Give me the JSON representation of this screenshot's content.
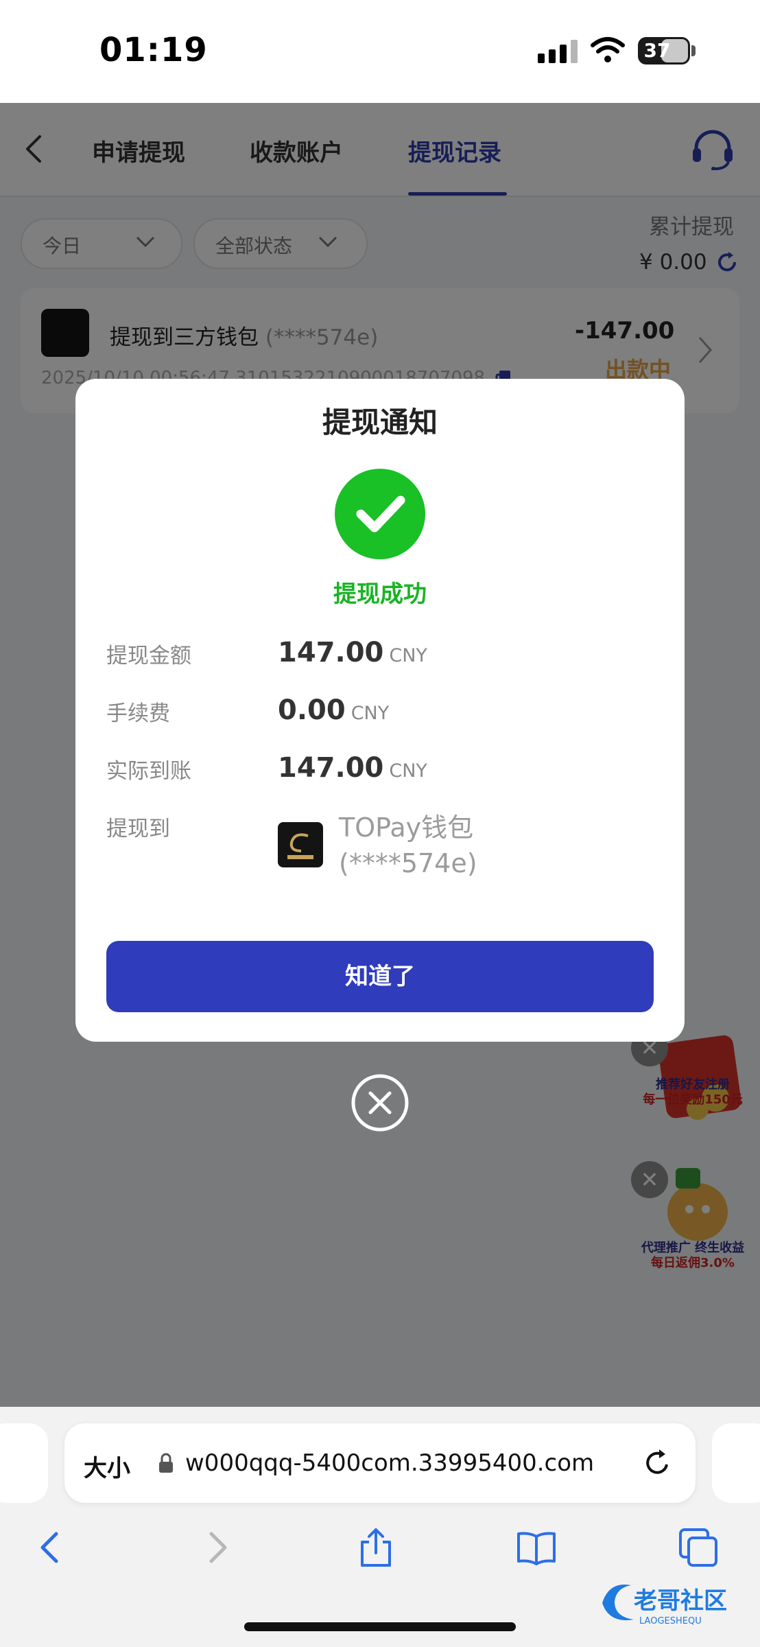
{
  "status_bar": {
    "time": "01:19",
    "battery": "37",
    "icons": [
      "cellular-signal-icon",
      "wifi-icon",
      "battery-icon"
    ]
  },
  "nav": {
    "tabs": [
      {
        "label": "申请提现",
        "active": false
      },
      {
        "label": "收款账户",
        "active": false
      },
      {
        "label": "提现记录",
        "active": true
      }
    ],
    "accent": "#2f3cad"
  },
  "filters": {
    "date": "今日",
    "status": "全部状态"
  },
  "summary": {
    "label": "累计提现",
    "value": "¥ 0.00"
  },
  "record": {
    "title": "提现到三方钱包",
    "account": "(****574e)",
    "amount": "-147.00",
    "status": "出款中",
    "meta": "2025/10/10 00:56:47  3101532210900018707098"
  },
  "promos": [
    {
      "caption_line1": "推荐好友注册",
      "caption_line2": "每一位奖励150元"
    },
    {
      "caption_line1": "代理推广 终生收益",
      "caption_line2": "每日返佣3.0%"
    }
  ],
  "modal": {
    "title": "提现通知",
    "result": "提现成功",
    "rows": [
      {
        "label": "提现金额",
        "value": "147.00",
        "unit": "CNY"
      },
      {
        "label": "手续费",
        "value": "0.00",
        "unit": "CNY"
      },
      {
        "label": "实际到账",
        "value": "147.00",
        "unit": "CNY"
      }
    ],
    "dest_label": "提现到",
    "dest_line1": "TOPay钱包",
    "dest_line2": "(****574e)",
    "confirm": "知道了",
    "success_color": "#19c026",
    "button_color": "#2f3cbc"
  },
  "browser": {
    "text_size": "大小",
    "url": "w000qqq-5400com.33995400.com"
  },
  "watermark": {
    "text": "老哥社区",
    "sub": "LAOGESHEQU"
  }
}
